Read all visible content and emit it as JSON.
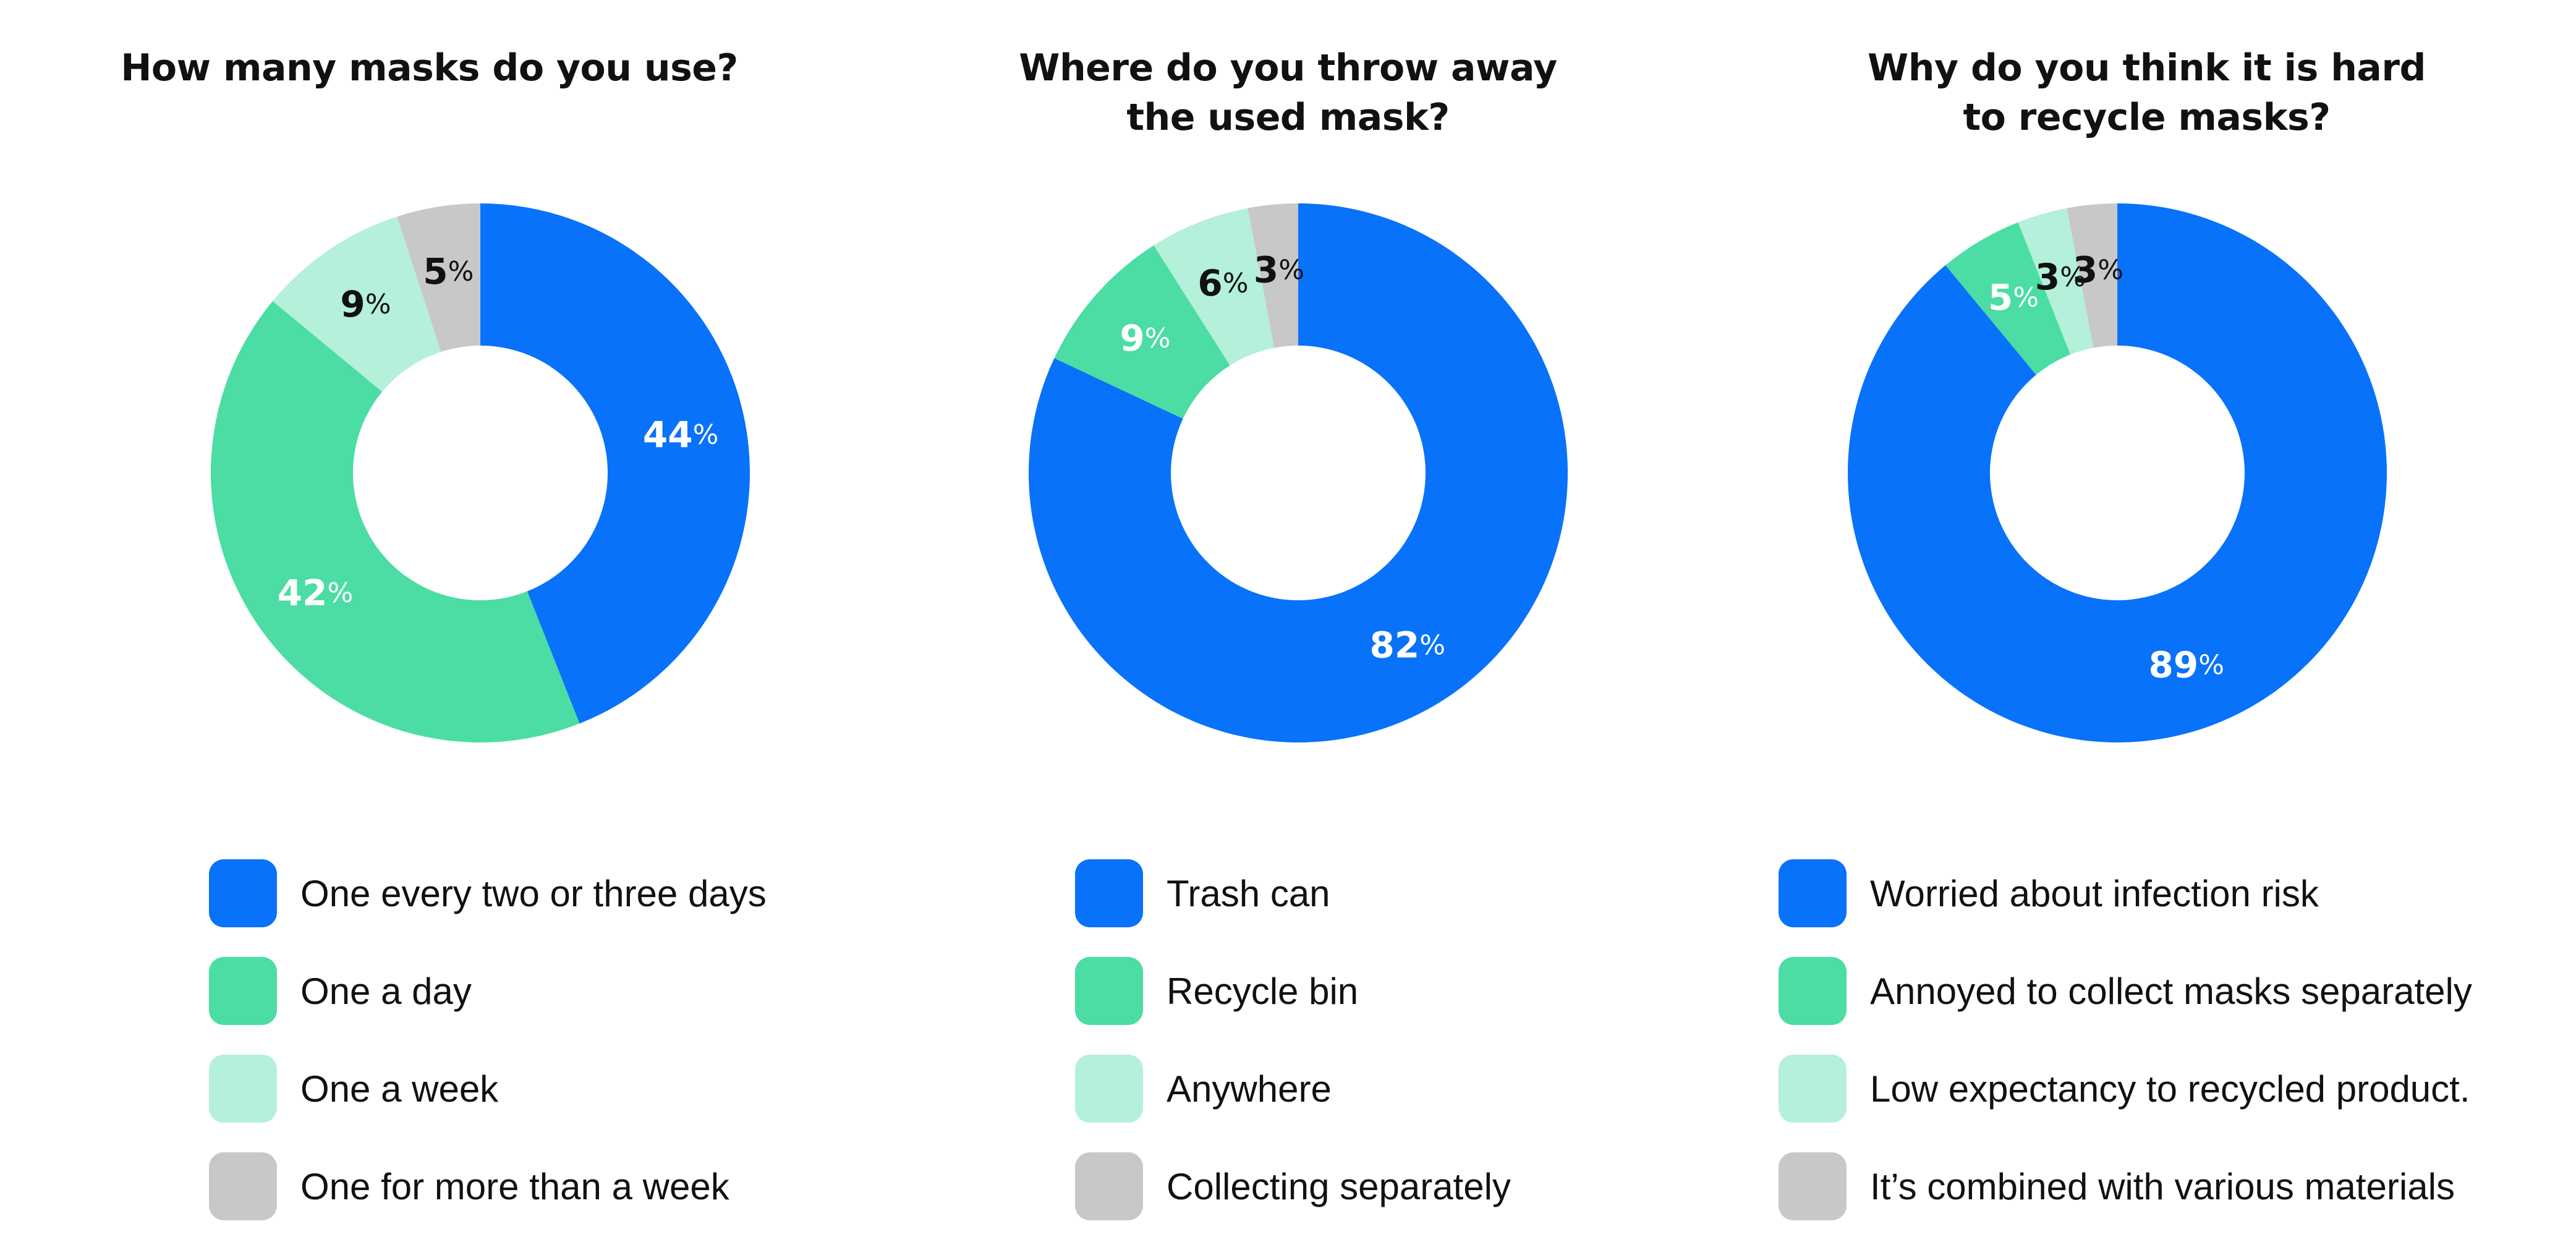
{
  "colors": {
    "blue": "#0872FA",
    "green": "#4BDDA3",
    "light_green": "#B4F0DA",
    "gray": "#C8C8C8",
    "white_text": "#FFFFFF",
    "dark_text": "#111111"
  },
  "chart_data": [
    {
      "type": "pie",
      "donut": true,
      "title": "How many masks do you use?",
      "categories": [
        "One every two or three days",
        "One a day",
        "One a week",
        "One for more than a week"
      ],
      "values": [
        44,
        42,
        9,
        5
      ],
      "labels": [
        "44",
        "42",
        "9",
        "5"
      ],
      "unit": "%",
      "colors": [
        "#0872FA",
        "#4BDDA3",
        "#B4F0DA",
        "#C8C8C8"
      ],
      "legend_position": "bottom"
    },
    {
      "type": "pie",
      "donut": true,
      "title": "Where do you throw away\nthe used mask?",
      "categories": [
        "Trash can",
        "Recycle bin",
        "Anywhere",
        "Collecting separately"
      ],
      "values": [
        82,
        9,
        6,
        3
      ],
      "labels": [
        "82",
        "9",
        "6",
        "3"
      ],
      "unit": "%",
      "colors": [
        "#0872FA",
        "#4BDDA3",
        "#B4F0DA",
        "#C8C8C8"
      ],
      "legend_position": "bottom"
    },
    {
      "type": "pie",
      "donut": true,
      "title": "Why do you think it is hard\nto recycle masks?",
      "categories": [
        "Worried about infection risk",
        "Annoyed to collect masks separately",
        "Low expectancy to recycled product.",
        "It’s combined with various materials"
      ],
      "values": [
        89,
        5,
        3,
        3
      ],
      "labels": [
        "89",
        "5",
        "3",
        "3"
      ],
      "unit": "%",
      "colors": [
        "#0872FA",
        "#4BDDA3",
        "#B4F0DA",
        "#C8C8C8"
      ],
      "legend_position": "bottom"
    }
  ]
}
